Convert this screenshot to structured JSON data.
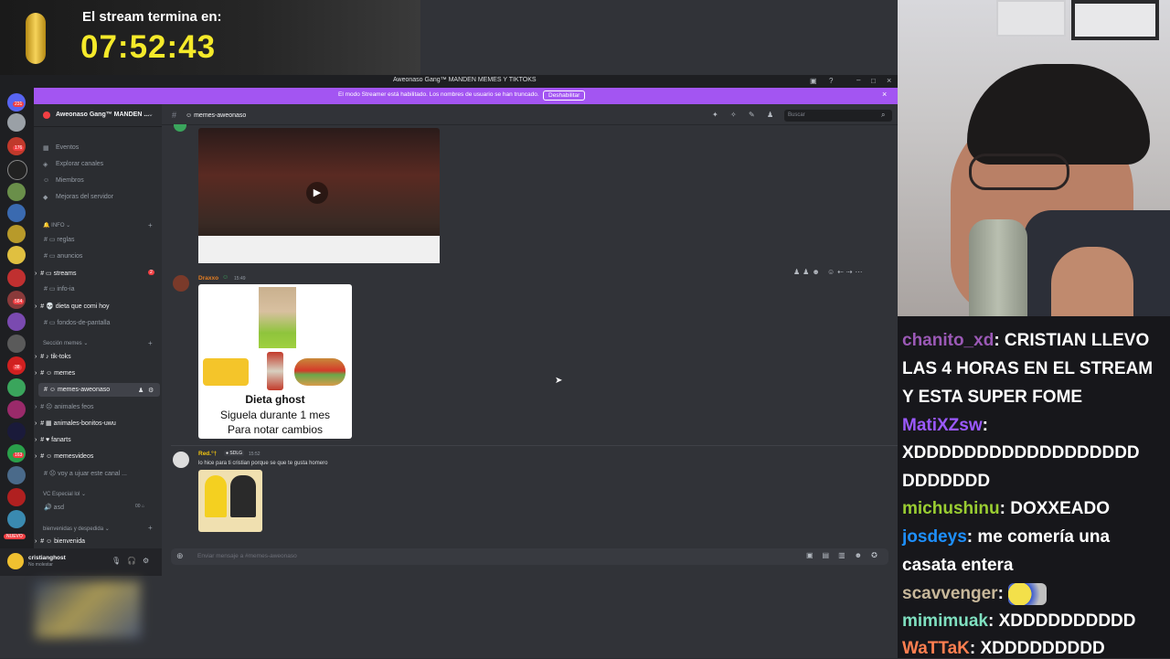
{
  "stream_overlay": {
    "timer_title": "El stream termina en:",
    "timer_value": "07:52:43"
  },
  "window": {
    "title": "Aweonaso Gang™ MANDEN MEMES Y TIKTOKS"
  },
  "streamer_banner": {
    "text": "El modo Streamer está habilitado. Los nombres de usuario se han truncado.",
    "button_label": "Deshabilitar"
  },
  "guild_rail": {
    "badges": [
      "231",
      "176",
      "584",
      "38",
      "163",
      "NUEVO"
    ]
  },
  "server": {
    "name": "Aweonaso Gang™ MANDEN ...",
    "nav_items": [
      "Eventos",
      "Explorar canales",
      "Miembros",
      "Mejoras del servidor"
    ],
    "categories": [
      {
        "name": "INFO",
        "channels": [
          {
            "name": "reglas",
            "badge": ""
          },
          {
            "name": "anuncios",
            "badge": ""
          },
          {
            "name": "streams",
            "badge": "2"
          },
          {
            "name": "info-ia",
            "badge": ""
          },
          {
            "name": "dieta que comi hoy",
            "badge": ""
          },
          {
            "name": "fondos-de-pantalla",
            "badge": ""
          }
        ]
      },
      {
        "name": "Sección memes",
        "channels": [
          {
            "name": "tik-toks",
            "badge": ""
          },
          {
            "name": "memes",
            "badge": ""
          },
          {
            "name": "memes-aweonaso",
            "badge": ""
          },
          {
            "name": "animales feos",
            "badge": ""
          },
          {
            "name": "animales-bonitos-uwu",
            "badge": ""
          },
          {
            "name": "fanarts",
            "badge": ""
          },
          {
            "name": "memesvideos",
            "badge": ""
          },
          {
            "name": "voy a ujuar este canal ...",
            "badge": ""
          }
        ]
      },
      {
        "name": "VC Especial lol",
        "channels": [
          {
            "name": "asd",
            "badge": ""
          }
        ]
      },
      {
        "name": "bienvenidas y despedida",
        "channels": [
          {
            "name": "bienvenida",
            "badge": ""
          }
        ]
      }
    ]
  },
  "user_panel": {
    "username": "cristianghost",
    "status": "No molestar"
  },
  "channel_header": {
    "channel_name": "memes-aweonaso",
    "search_placeholder": "Buscar"
  },
  "messages": [
    {
      "author": "Draxxo",
      "time": "15:49",
      "author_color": "#e67e22",
      "meme_lines": [
        "Dieta ghost",
        "Siguela durante 1 mes",
        "Para notar cambios"
      ]
    },
    {
      "author": "Red.°†",
      "tag": "SDLG",
      "time": "15:52",
      "author_color": "#f1c40f",
      "text": "lo hice para ti cristian porque se que te gusta homero"
    }
  ],
  "composer": {
    "placeholder": "Enviar mensaje a #memes-aweonaso"
  },
  "chat": {
    "lines": [
      {
        "user": "chanito_xd",
        "color": "#9b59b6",
        "text": "CRISTIAN LLEVO"
      },
      {
        "user": "",
        "color": "",
        "text": "LAS 4 HORAS EN EL STREAM"
      },
      {
        "user": "",
        "color": "",
        "text": "Y ESTA SUPER FOME"
      },
      {
        "user": "MatiXZsw",
        "color": "#9b59ff",
        "text": ""
      },
      {
        "user": "",
        "color": "",
        "text": "XDDDDDDDDDDDDDDDDDD"
      },
      {
        "user": "",
        "color": "",
        "text": "DDDDDDD"
      },
      {
        "user": "michushinu",
        "color": "#9acd32",
        "text": "DOXXEADO"
      },
      {
        "user": "josdeys",
        "color": "#1e90ff",
        "text": "me comería una"
      },
      {
        "user": "",
        "color": "",
        "text": "casata entera"
      },
      {
        "user": "scavvenger",
        "color": "#c8b89a",
        "text": ""
      },
      {
        "user": "mimimuak",
        "color": "#7fe0c0",
        "text": "XDDDDDDDDDD"
      },
      {
        "user": "WaTTaK",
        "color": "#ff7f50",
        "text": "XDDDDDDDDD"
      }
    ]
  }
}
